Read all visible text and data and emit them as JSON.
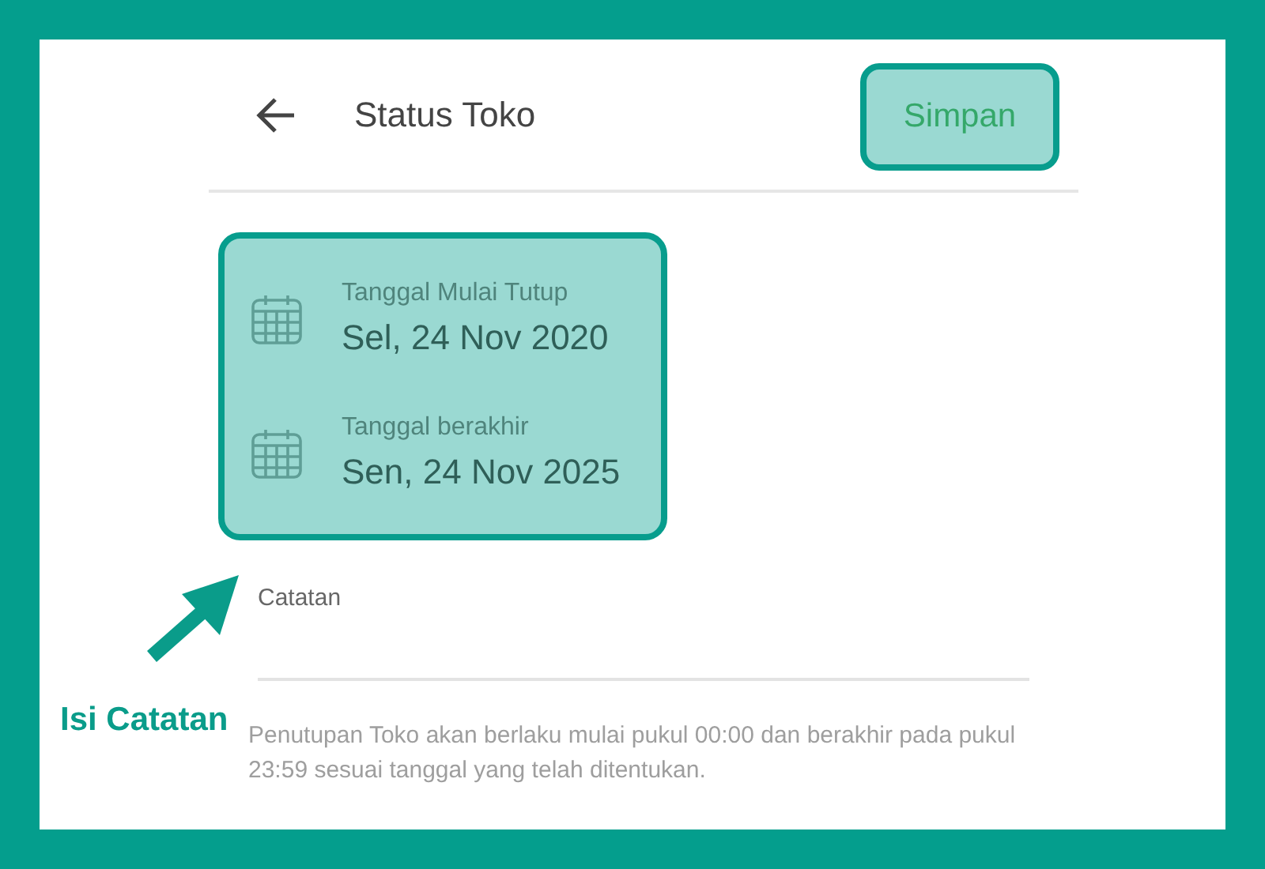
{
  "header": {
    "title": "Status Toko"
  },
  "save_button": {
    "label": "Simpan"
  },
  "dates": [
    {
      "label": "Tanggal Mulai Tutup",
      "value": "Sel, 24 Nov 2020"
    },
    {
      "label": "Tanggal berakhir",
      "value": "Sen, 24 Nov 2025"
    }
  ],
  "note_field": {
    "placeholder": "Catatan"
  },
  "help_text": "Penutupan Toko akan berlaku mulai pukul 00:00 dan berakhir pada pukul 23:59 sesuai tanggal yang telah ditentukan.",
  "annotation": {
    "label": "Isi Catatan"
  }
}
